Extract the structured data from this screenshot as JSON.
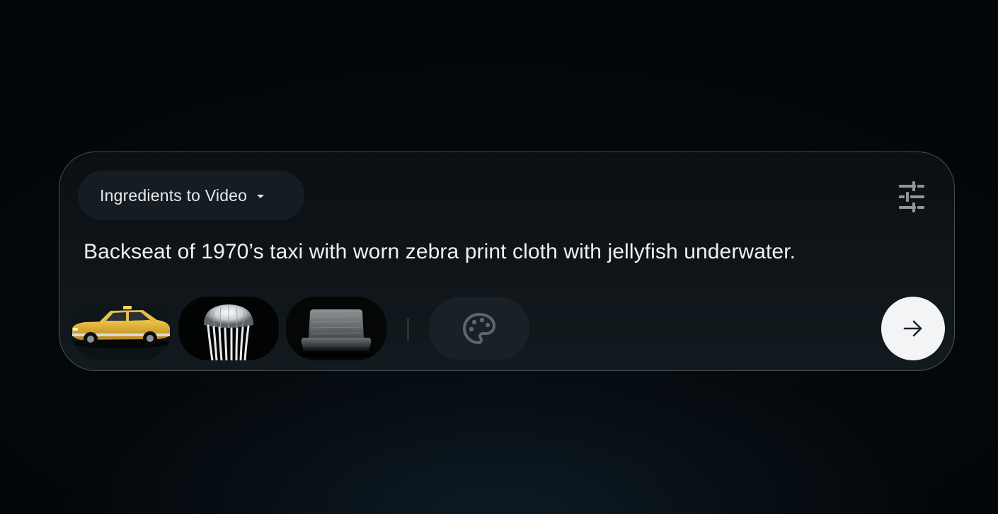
{
  "composer": {
    "mode_label": "Ingredients to Video",
    "prompt_text": "Backseat of 1970’s taxi with worn zebra print cloth with jellyfish underwater.",
    "settings_icon": "sliders-icon",
    "style_icon": "palette-icon",
    "send_icon": "arrow-right-icon",
    "ingredients": [
      {
        "icon": "taxi-image"
      },
      {
        "icon": "jellyfish-image"
      },
      {
        "icon": "car-seat-image"
      }
    ]
  },
  "colors": {
    "background": "#030608",
    "panel": "#0f1519",
    "pill": "#161d22",
    "send_button": "#f3f4f5"
  }
}
